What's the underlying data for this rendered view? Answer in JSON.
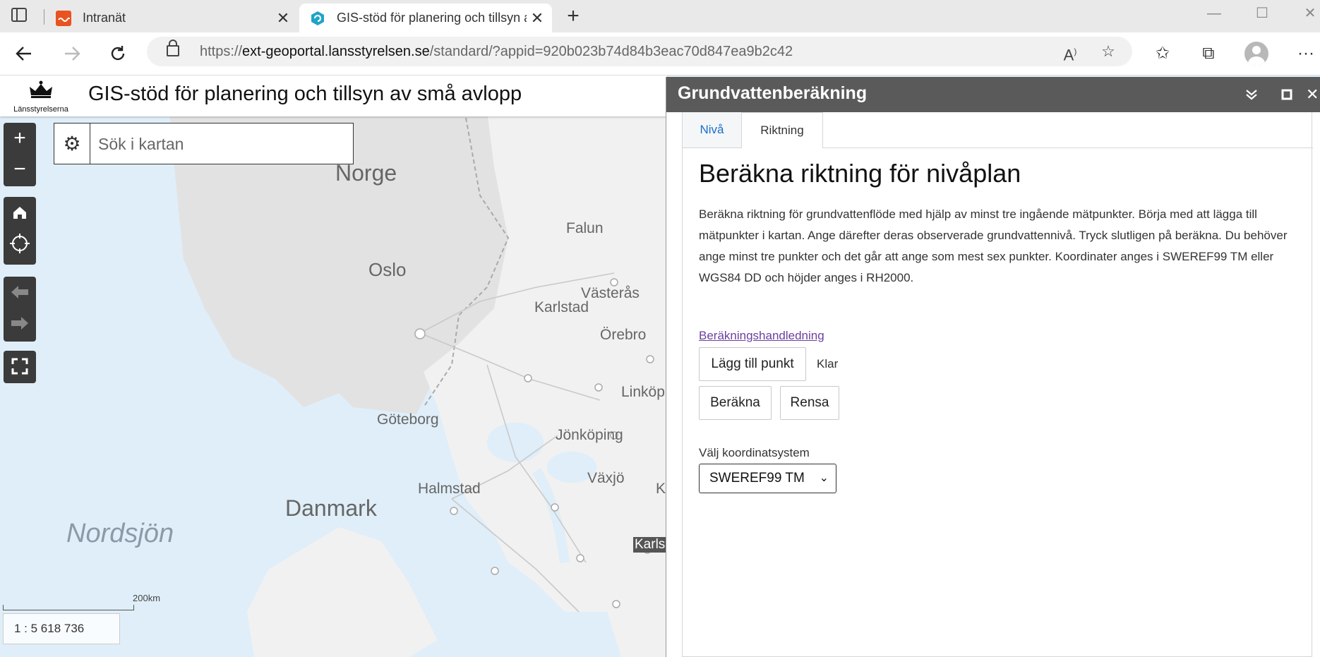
{
  "browser": {
    "tabs": [
      {
        "title": "Intranät",
        "favicon": "intranet-icon",
        "active": false
      },
      {
        "title": "GIS-stöd för planering och tillsyn av små avlopp",
        "favicon": "arcgis-icon",
        "active": true
      }
    ],
    "url": {
      "scheme": "https://",
      "domain": "ext-geoportal.lansstyrelsen.se",
      "path": "/standard/?appid=920b023b74d84b3eac70d847ea9b2c42"
    }
  },
  "app": {
    "logo_text": "Länsstyrelserna",
    "title": "GIS-stöd för planering och tillsyn av små avlopp"
  },
  "search": {
    "placeholder": "Sök i kartan"
  },
  "map": {
    "labels": [
      {
        "text": "Norge",
        "kind": "country"
      },
      {
        "text": "Oslo",
        "kind": "city"
      },
      {
        "text": "Falun",
        "kind": "city"
      },
      {
        "text": "Västerås",
        "kind": "city"
      },
      {
        "text": "Karlstad",
        "kind": "city"
      },
      {
        "text": "Örebro",
        "kind": "city"
      },
      {
        "text": "Linköp",
        "kind": "city"
      },
      {
        "text": "Göteborg",
        "kind": "city"
      },
      {
        "text": "Jönköping",
        "kind": "city"
      },
      {
        "text": "Växjö",
        "kind": "city"
      },
      {
        "text": "Halmstad",
        "kind": "city"
      },
      {
        "text": "K",
        "kind": "city"
      },
      {
        "text": "Danmark",
        "kind": "country"
      },
      {
        "text": "Nordsjön",
        "kind": "sea"
      },
      {
        "text": "Karlsk",
        "kind": "city"
      }
    ],
    "scalebar_label": "200km",
    "scale": "1 : 5 618 736"
  },
  "panel": {
    "title": "Grundvattenberäkning",
    "tabs": [
      {
        "label": "Nivå",
        "active": false
      },
      {
        "label": "Riktning",
        "active": true
      }
    ],
    "heading": "Beräkna riktning för nivåplan",
    "description": "Beräkna riktning för grundvattenflöde med hjälp av minst tre ingående mätpunkter. Börja med att lägga till mätpunkter i kartan. Ange därefter deras observerade grundvattennivå. Tryck slutligen på beräkna. Du behöver ange minst tre punkter och det går att ange som mest sex punkter. Koordinater anges i SWEREF99 TM eller WGS84 DD och höjder anges i RH2000.",
    "guide_link": "Beräkningshandledning",
    "add_point_label": "Lägg till punkt",
    "status": "Klar",
    "calc_label": "Beräkna",
    "clear_label": "Rensa",
    "coord_label": "Välj koordinatsystem",
    "coord_selected": "SWEREF99 TM"
  },
  "colors": {
    "panel_header": "#5a5a5a",
    "tab_active_text": "#1a6fc9",
    "link": "#6b3fa0",
    "map_water": "#dfeef8",
    "map_land": "#f2f2f2"
  }
}
